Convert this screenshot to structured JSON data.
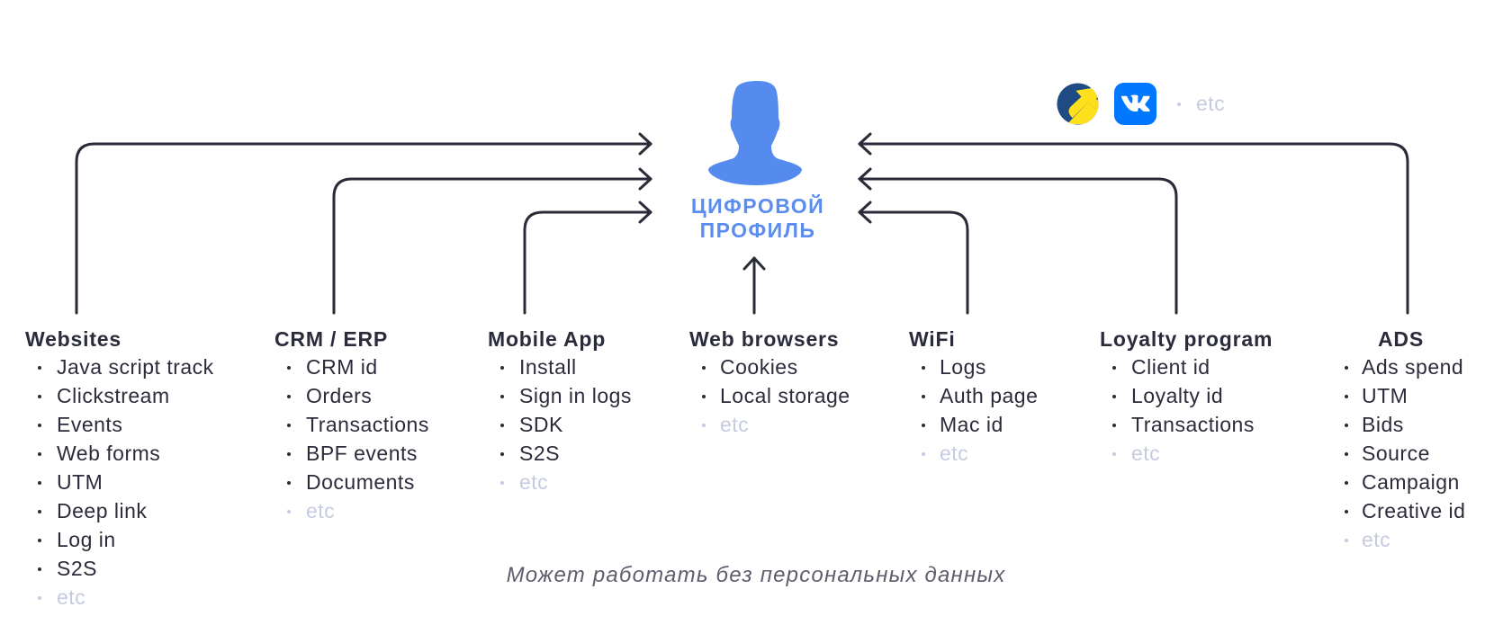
{
  "profile": {
    "title_line1": "ЦИФРОВОЙ",
    "title_line2": "ПРОФИЛЬ",
    "icon": "person-icon"
  },
  "partners": {
    "logos": [
      {
        "name": "yandex-logo"
      },
      {
        "name": "vk-logo"
      }
    ],
    "etc": "etc"
  },
  "sources": [
    {
      "title": "Websites",
      "items": [
        "Java script track",
        "Clickstream",
        "Events",
        "Web forms",
        "UTM",
        "Deep link",
        "Log in",
        "S2S"
      ],
      "etc": "etc"
    },
    {
      "title": "CRM / ERP",
      "items": [
        "CRM id",
        "Orders",
        "Transactions",
        "BPF events",
        "Documents"
      ],
      "etc": "etc"
    },
    {
      "title": "Mobile App",
      "items": [
        "Install",
        "Sign in logs",
        "SDK",
        "S2S"
      ],
      "etc": "etc"
    },
    {
      "title": "Web browsers",
      "items": [
        "Cookies",
        "Local storage"
      ],
      "etc": "etc"
    },
    {
      "title": "WiFi",
      "items": [
        "Logs",
        "Auth page",
        "Mac id"
      ],
      "etc": "etc"
    },
    {
      "title": "Loyalty program",
      "items": [
        "Client id",
        "Loyalty id",
        "Transactions"
      ],
      "etc": "etc"
    },
    {
      "title": "ADS",
      "items": [
        "Ads spend",
        "UTM",
        "Bids",
        "Source",
        "Campaign",
        "Creative id"
      ],
      "etc": "etc"
    }
  ],
  "footer_note": "Может работать без персональных данных",
  "colors": {
    "accent": "#5b8def",
    "line": "#2a2b38",
    "text": "#2b2c3b",
    "muted": "#c6cbdf",
    "footer": "#5d5e6e",
    "yandex_blue": "#1e4b83",
    "yandex_yellow": "#fee01d",
    "vk_blue": "#0077ff"
  }
}
